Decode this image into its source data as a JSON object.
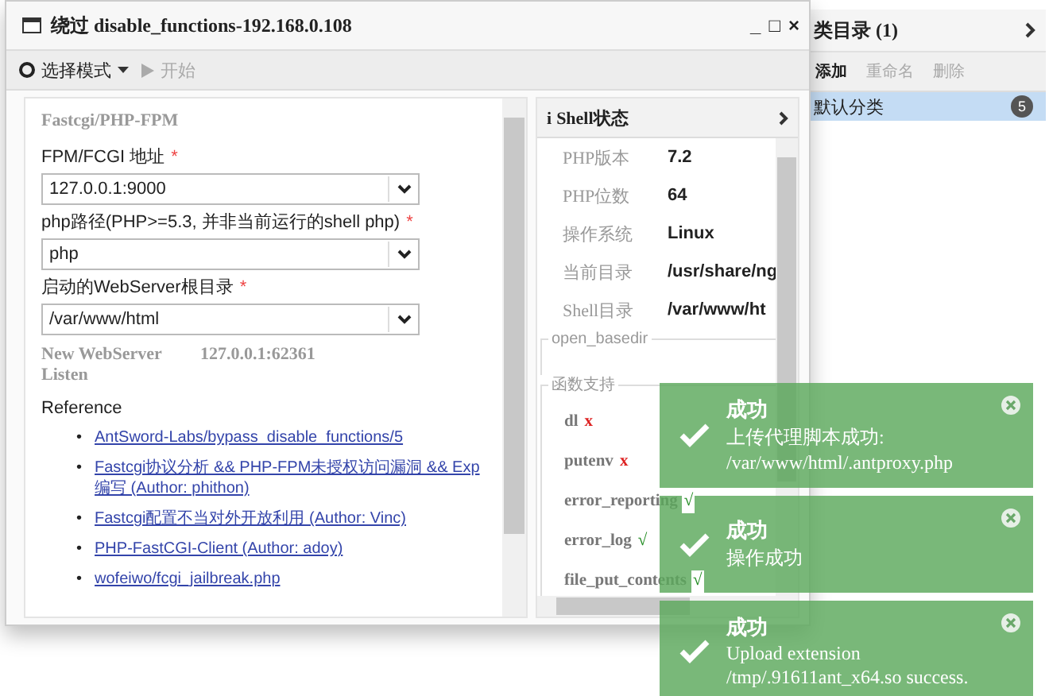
{
  "window": {
    "title": "绕过 disable_functions-192.168.0.108",
    "controls": [
      "_",
      "□",
      "×"
    ]
  },
  "info_mark": "i",
  "toolbar": [
    {
      "kind": "mode",
      "label": "选择模式",
      "disabled": false
    },
    {
      "kind": "start",
      "label": "开始",
      "disabled": true
    }
  ],
  "form": {
    "group": "Fastcgi/PHP-FPM",
    "fields": [
      {
        "label": "FPM/FCGI 地址",
        "required": true,
        "required_mark": "*",
        "value": "127.0.0.1:9000"
      },
      {
        "label": "php路径(PHP>=5.3, 并非当前运行的shell php)",
        "required": true,
        "required_mark": "*",
        "value": "php"
      },
      {
        "label": "启动的WebServer根目录",
        "required": true,
        "required_mark": "*",
        "value": "/var/www/html"
      }
    ],
    "listen": {
      "label": "New WebServer Listen",
      "value": "127.0.0.1:62361"
    },
    "reference": {
      "title": "Reference",
      "links": [
        {
          "bullet": "•",
          "text": "AntSword-Labs/bypass_disable_functions/5"
        },
        {
          "bullet": "•",
          "text": "Fastcgi协议分析 && PHP-FPM未授权访问漏洞 && Exp编写 (Author: phithon)"
        },
        {
          "bullet": "•",
          "text": "Fastcgi配置不当对外开放利用 (Author: Vinc)"
        },
        {
          "bullet": "•",
          "text": "PHP-FastCGI-Client (Author: adoy)"
        },
        {
          "bullet": "•",
          "text": "wofeiwo/fcgi_jailbreak.php"
        }
      ]
    }
  },
  "shell_status": {
    "title": "Shell状态",
    "rows": [
      {
        "label": "PHP版本",
        "value": "7.2"
      },
      {
        "label": "PHP位数",
        "value": "64"
      },
      {
        "label": "操作系统",
        "value": "Linux"
      },
      {
        "label": "当前目录",
        "value": "/usr/share/ng"
      },
      {
        "label": "Shell目录",
        "value": "/var/www/ht"
      }
    ],
    "open_basedir": "open_basedir",
    "functions_title": "函数支持",
    "functions": [
      {
        "name": "dl",
        "supported": false,
        "mark": "x"
      },
      {
        "name": "putenv",
        "supported": false,
        "mark": "x"
      },
      {
        "name": "error_reporting",
        "supported": true,
        "mark": "√"
      },
      {
        "name": "error_log",
        "supported": true,
        "mark": "√"
      },
      {
        "name": "file_put_contents",
        "supported": true,
        "mark": "√"
      }
    ]
  },
  "category_panel": {
    "title": "类目录 (1)",
    "buttons": [
      {
        "label": "添加",
        "disabled": false
      },
      {
        "label": "重命名",
        "disabled": true
      },
      {
        "label": "删除",
        "disabled": true
      }
    ],
    "items": [
      {
        "name": "默认分类",
        "count": "5",
        "selected": true
      }
    ]
  },
  "toasts": [
    {
      "title": "成功",
      "lines": [
        "上传代理脚本成功:",
        "/var/www/html/.antproxy.php"
      ]
    },
    {
      "title": "成功",
      "lines": [
        "操作成功"
      ]
    },
    {
      "title": "成功",
      "lines": [
        "Upload extension",
        "/tmp/.91611ant_x64.so success."
      ]
    }
  ]
}
